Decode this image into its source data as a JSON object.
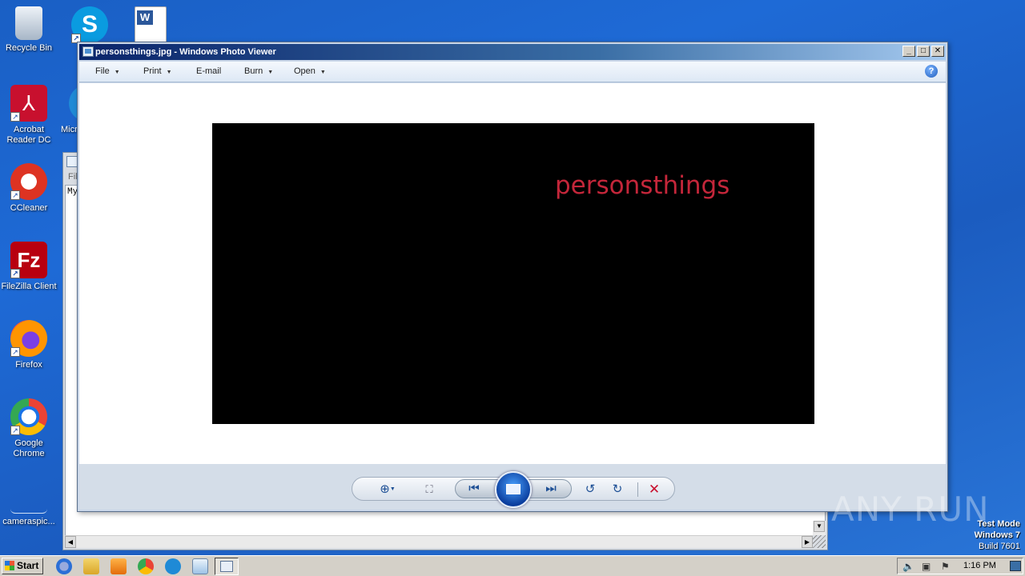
{
  "desktop": {
    "icons": [
      {
        "label": "Recycle Bin"
      },
      {
        "label": "Acrobat Reader DC"
      },
      {
        "label": "Micr"
      },
      {
        "label": "CCleaner"
      },
      {
        "label": "FileZilla Client"
      },
      {
        "label": "Firefox"
      },
      {
        "label": "Google Chrome"
      },
      {
        "label": "cameraspic..."
      }
    ]
  },
  "background_window": {
    "fragment_menu": "Fil",
    "fragment_text": "My"
  },
  "photo_viewer": {
    "title": "personsthings.jpg - Windows Photo Viewer",
    "menu": [
      {
        "label": "File",
        "has_dropdown": true
      },
      {
        "label": "Print",
        "has_dropdown": true
      },
      {
        "label": "E-mail",
        "has_dropdown": false
      },
      {
        "label": "Burn",
        "has_dropdown": true
      },
      {
        "label": "Open",
        "has_dropdown": true
      }
    ],
    "help_label": "?",
    "image_text": "personsthings",
    "image_text_color": "#c4263a",
    "controls": {
      "zoom_icon": "zoom-icon",
      "actual_size_icon": "actual-size-icon",
      "previous_icon": "previous-icon",
      "slideshow_icon": "slideshow-icon",
      "next_icon": "next-icon",
      "rotate_ccw_icon": "rotate-counterclockwise-icon",
      "rotate_cw_icon": "rotate-clockwise-icon",
      "delete_icon": "delete-icon"
    }
  },
  "watermark": {
    "text": "ANY RUN"
  },
  "system_info": {
    "line1": "Test Mode",
    "line2": "Windows 7",
    "line3": "Build 7601"
  },
  "taskbar": {
    "start_label": "Start",
    "clock": "1:16 PM"
  }
}
